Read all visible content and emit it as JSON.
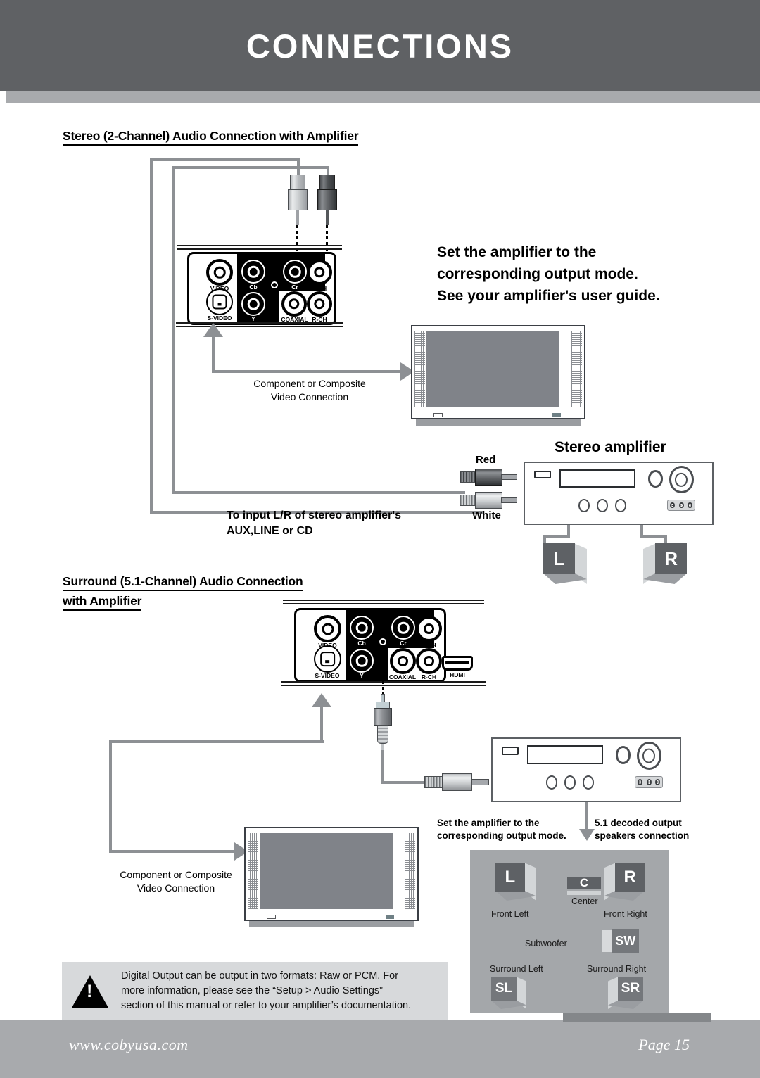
{
  "header": {
    "title": "CONNECTIONS"
  },
  "sections": {
    "stereo": {
      "heading": "Stereo (2-Channel) Audio Connection with Amplifier",
      "amplifier_note": "Set the amplifier to the corresponding output mode. See your amplifier's user guide.",
      "amplifier_note_lines": [
        "Set the amplifier to the",
        "corresponding output mode.",
        "See your amplifier's user guide."
      ],
      "video_caption_lines": [
        "Component or Composite",
        "Video Connection"
      ],
      "amp_title": "Stereo amplifier",
      "cable_red_label": "Red",
      "cable_white_label": "White",
      "input_note_lines": [
        "To input L/R of stereo amplifier's",
        "AUX,LINE or CD"
      ],
      "speakers": [
        {
          "code": "L",
          "name": "left-speaker"
        },
        {
          "code": "R",
          "name": "right-speaker"
        }
      ]
    },
    "surround": {
      "heading_lines": [
        "Surround (5.1-Channel) Audio Connection ",
        "with Amplifier"
      ],
      "video_caption_lines": [
        "Component or Composite",
        "Video Connection"
      ],
      "amplifier_note_lines": [
        "Set the amplifier to the",
        "corresponding output mode."
      ],
      "decoded_note_lines": [
        "5.1 decoded output",
        "speakers connection"
      ],
      "speaker_layout": [
        {
          "code": "L",
          "label": "Front Left"
        },
        {
          "code": "C",
          "label": "Center"
        },
        {
          "code": "R",
          "label": "Front Right"
        },
        {
          "code": "SW",
          "label": "Subwoofer"
        },
        {
          "code": "SL",
          "label": "Surround Left"
        },
        {
          "code": "SR",
          "label": "Surround Right"
        }
      ]
    }
  },
  "rear_panel": {
    "jacks": [
      "VIDEO",
      "S-VIDEO",
      "Cb",
      "Y",
      "Cr",
      "COAXIAL",
      "L-CH",
      "R-CH"
    ],
    "hdmi_label": "HDMI"
  },
  "note": {
    "text": "Digital Output can be output in two formats: Raw or PCM. For more information, please see the “Setup > Audio Settings” section of this manual or refer to your amplifier’s documentation.",
    "lines": [
      "Digital Output can be output in two formats: Raw or PCM. For",
      "more information, please see the “Setup > Audio Settings”",
      "section of this manual or refer to your amplifier’s documentation."
    ]
  },
  "footer": {
    "url": "www.cobyusa.com",
    "page": "Page 15"
  },
  "colors": {
    "header_bar": "#5f6164",
    "header_band": "#a8aaad",
    "footer": "#a8aaad",
    "wire": "#8d9094",
    "speaker_dark": "#5e6165",
    "layout_box": "#a4a7aa",
    "note_box": "#d7d9db"
  }
}
